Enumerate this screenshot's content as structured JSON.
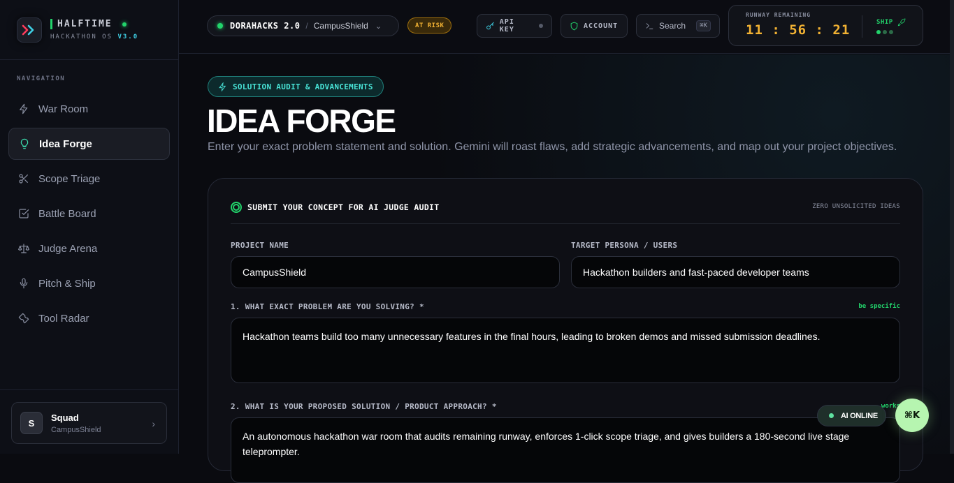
{
  "brand": {
    "title": "HALFTIME",
    "subtitle": "HACKATHON OS",
    "version": "V3.0"
  },
  "nav": {
    "label": "NAVIGATION",
    "items": [
      {
        "label": "War Room",
        "icon": "bolt-icon"
      },
      {
        "label": "Idea Forge",
        "icon": "lightbulb-icon",
        "active": true
      },
      {
        "label": "Scope Triage",
        "icon": "scissors-icon"
      },
      {
        "label": "Battle Board",
        "icon": "checkbox-icon"
      },
      {
        "label": "Judge Arena",
        "icon": "scale-icon"
      },
      {
        "label": "Pitch & Ship",
        "icon": "microphone-icon"
      },
      {
        "label": "Tool Radar",
        "icon": "wrench-icon"
      }
    ]
  },
  "squad": {
    "avatar": "S",
    "name": "Squad",
    "project": "CampusShield"
  },
  "topbar": {
    "org": "DORAHACKS 2.0",
    "separator": "/",
    "project": "CampusShield",
    "status": "AT RISK",
    "api_key": "API KEY",
    "account": "ACCOUNT",
    "search": "Search",
    "search_shortcut": "⌘K",
    "runway_label": "RUNWAY REMAINING",
    "runway_time": "11 : 56 : 21",
    "ship_label": "SHIP"
  },
  "page": {
    "badge": "SOLUTION AUDIT & ADVANCEMENTS",
    "title": "IDEA FORGE",
    "subtitle": "Enter your exact problem statement and solution. Gemini will roast flaws, add strategic advancements, and map out your project objectives."
  },
  "form": {
    "heading": "SUBMIT YOUR CONCEPT FOR AI JUDGE AUDIT",
    "note": "ZERO UNSOLICITED IDEAS",
    "project_name_label": "PROJECT NAME",
    "project_name_value": "CampusShield",
    "persona_label": "TARGET PERSONA / USERS",
    "persona_value": "Hackathon builders and fast-paced developer teams",
    "problem_label": "1. WHAT EXACT PROBLEM ARE YOU SOLVING? *",
    "problem_hint": "be specific",
    "problem_value": "Hackathon teams build too many unnecessary features in the final hours, leading to broken demos and missed submission deadlines.",
    "solution_label": "2. WHAT IS YOUR PROPOSED SOLUTION / PRODUCT APPROACH? *",
    "solution_hint": "works",
    "solution_value": "An autonomous hackathon war room that audits remaining runway, enforces 1-click scope triage, and gives builders a 180-second live stage teleprompter."
  },
  "floating": {
    "ai_status": "AI ONLINE",
    "cmdk": "⌘K"
  },
  "colors": {
    "accent_green": "#22d36b",
    "accent_cyan": "#48e3d6",
    "warning": "#f2b233"
  }
}
